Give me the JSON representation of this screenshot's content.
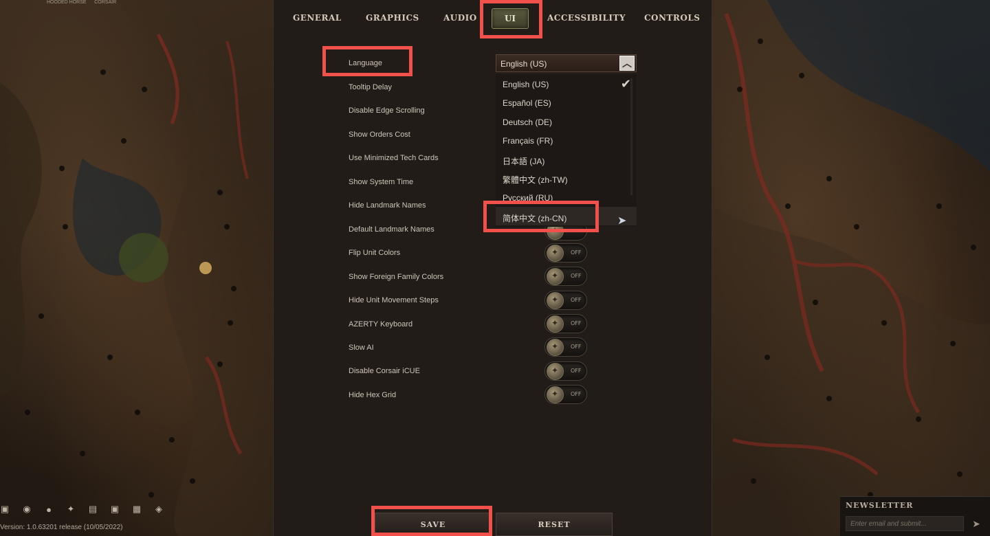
{
  "brand": {
    "logos": [
      "HOODED HORSE",
      "CORSAIR"
    ]
  },
  "tabs": [
    {
      "id": "general",
      "label": "GENERAL"
    },
    {
      "id": "graphics",
      "label": "GRAPHICS"
    },
    {
      "id": "audio",
      "label": "AUDIO"
    },
    {
      "id": "ui",
      "label": "UI",
      "selected": true
    },
    {
      "id": "accessibility",
      "label": "ACCESSIBILITY"
    },
    {
      "id": "controls",
      "label": "CONTROLS"
    }
  ],
  "settings": {
    "language": {
      "label": "Language",
      "selected": "English (US)",
      "options": [
        {
          "label": "English (US)",
          "checked": true
        },
        {
          "label": "Español (ES)"
        },
        {
          "label": "Deutsch (DE)"
        },
        {
          "label": "Français (FR)"
        },
        {
          "label": "日本語 (JA)"
        },
        {
          "label": "繁體中文 (zh-TW)"
        },
        {
          "label": "Русский (RU)"
        },
        {
          "label": "简体中文 (zh-CN)",
          "hovered": true
        }
      ]
    },
    "rows": [
      {
        "label": "Tooltip Delay"
      },
      {
        "label": "Disable Edge Scrolling"
      },
      {
        "label": "Show Orders Cost"
      },
      {
        "label": "Use Minimized Tech Cards"
      },
      {
        "label": "Show System Time"
      },
      {
        "label": "Hide Landmark Names"
      },
      {
        "label": "Default Landmark Names"
      },
      {
        "label": "Flip Unit Colors",
        "state": "OFF"
      },
      {
        "label": "Show Foreign Family Colors",
        "state": "OFF"
      },
      {
        "label": "Hide Unit Movement Steps",
        "state": "OFF"
      },
      {
        "label": "AZERTY Keyboard",
        "state": "OFF"
      },
      {
        "label": "Slow AI",
        "state": "OFF"
      },
      {
        "label": "Disable Corsair iCUE",
        "state": "OFF"
      },
      {
        "label": "Hide Hex Grid",
        "state": "OFF"
      }
    ]
  },
  "actions": {
    "save": "SAVE",
    "reset": "RESET"
  },
  "footer": {
    "version": "Version: 1.0.63201 release (10/05/2022)",
    "social_icons": [
      "steam-icon",
      "discord-icon",
      "reddit-icon",
      "twitter-icon",
      "twitch-icon",
      "youtube-icon",
      "forum-icon",
      "wiki-icon"
    ]
  },
  "newsletter": {
    "title": "NEWSLETTER",
    "placeholder": "Enter email and submit..."
  },
  "colors": {
    "highlight": "#f2504a",
    "panel": "#221c19",
    "selected_tab": "#4d4d36"
  }
}
